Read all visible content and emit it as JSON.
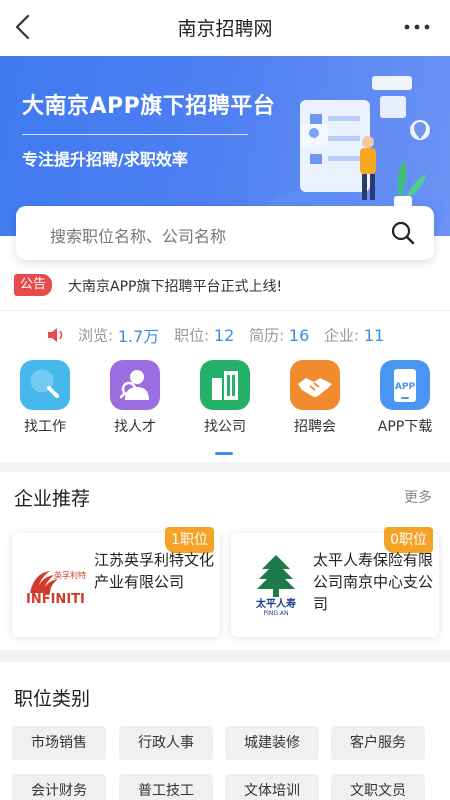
{
  "header": {
    "title": "南京招聘网",
    "back_icon": "back-chevron-icon",
    "more_icon": "more-dots-icon"
  },
  "banner": {
    "headline": "大南京APP旗下招聘平台",
    "subline": "专注提升招聘/求职效率"
  },
  "search": {
    "placeholder": "搜索职位名称、公司名称",
    "icon": "search-icon"
  },
  "notice": {
    "tag": "公告",
    "text": "大南京APP旗下招聘平台正式上线!"
  },
  "stats": {
    "views_label": "浏览:",
    "views": "1.7万",
    "jobs_label": "职位:",
    "jobs": "12",
    "resumes_label": "简历:",
    "resumes": "16",
    "companies_label": "企业:",
    "companies": "11"
  },
  "quick_links": [
    {
      "label": "找工作",
      "icon": "magnifier-icon",
      "color": "#46b8ec"
    },
    {
      "label": "找人才",
      "icon": "talent-person-icon",
      "color": "#9a6ee0"
    },
    {
      "label": "找公司",
      "icon": "building-icon",
      "color": "#22b06a"
    },
    {
      "label": "招聘会",
      "icon": "handshake-icon",
      "color": "#f28a2e"
    },
    {
      "label": "APP下载",
      "icon": "app-download-icon",
      "color": "#4a94f2"
    }
  ],
  "companies_section": {
    "title": "企业推荐",
    "more": "更多",
    "items": [
      {
        "badge": "1职位",
        "name": "江苏英孚利特文化产业有限公司",
        "logo_text": "INFINITI",
        "logo_sub": "英孚利特"
      },
      {
        "badge": "0职位",
        "name": "太平人寿保险有限公司南京中心支公司",
        "logo_text": "太平人寿",
        "logo_sub": "PING AN"
      }
    ]
  },
  "categories_section": {
    "title": "职位类别",
    "row1": [
      "市场销售",
      "行政人事",
      "城建装修",
      "客户服务"
    ],
    "row2": [
      "会计财务",
      "普工技工",
      "文体培训",
      "文职文员"
    ]
  },
  "colors": {
    "accent": "#3a8ee6",
    "badge": "#f4a328",
    "notice": "#e84b4b",
    "banner": "#4d7ff2"
  }
}
